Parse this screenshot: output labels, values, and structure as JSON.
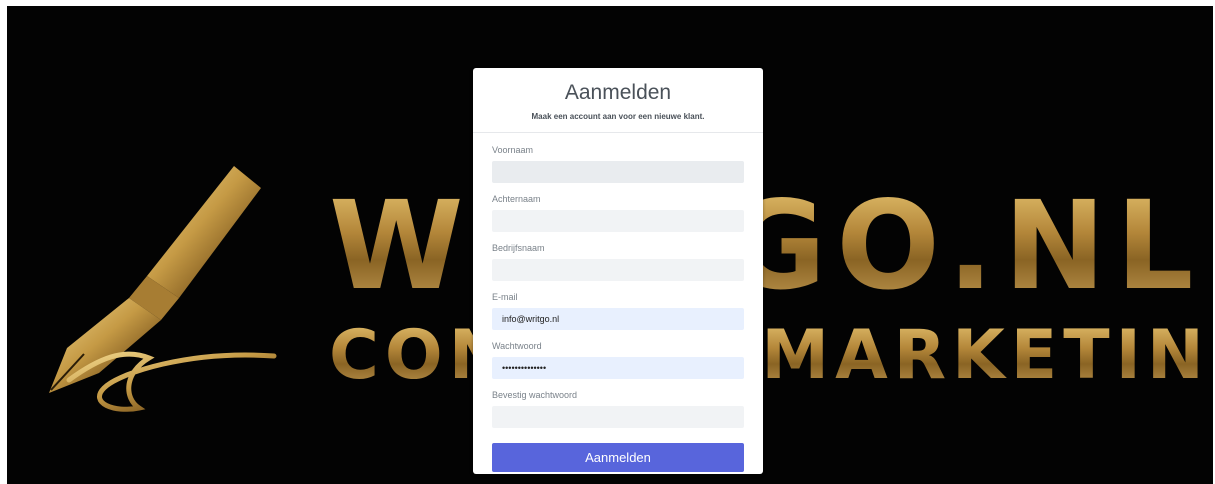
{
  "background": {
    "brand_line_1": "WRITGO.NL",
    "brand_line_2": "CONTENT MARKETING",
    "colors": {
      "backdrop": "#030303",
      "gold": "#c9a254"
    }
  },
  "form": {
    "title": "Aanmelden",
    "subtitle": "Maak een account aan voor een nieuwe klant.",
    "fields": [
      {
        "label": "Voornaam",
        "value": "",
        "type": "text"
      },
      {
        "label": "Achternaam",
        "value": "",
        "type": "text"
      },
      {
        "label": "Bedrijfsnaam",
        "value": "",
        "type": "text"
      },
      {
        "label": "E-mail",
        "value": "info@writgo.nl",
        "type": "email"
      },
      {
        "label": "Wachtwoord",
        "value": "••••••••••••••",
        "type": "password"
      },
      {
        "label": "Bevestig wachtwoord",
        "value": "",
        "type": "password"
      }
    ],
    "submit_label": "Aanmelden",
    "colors": {
      "primary": "#5865dc",
      "input_bg": "#f1f3f5",
      "autofill_bg": "#e8f0fe"
    }
  }
}
